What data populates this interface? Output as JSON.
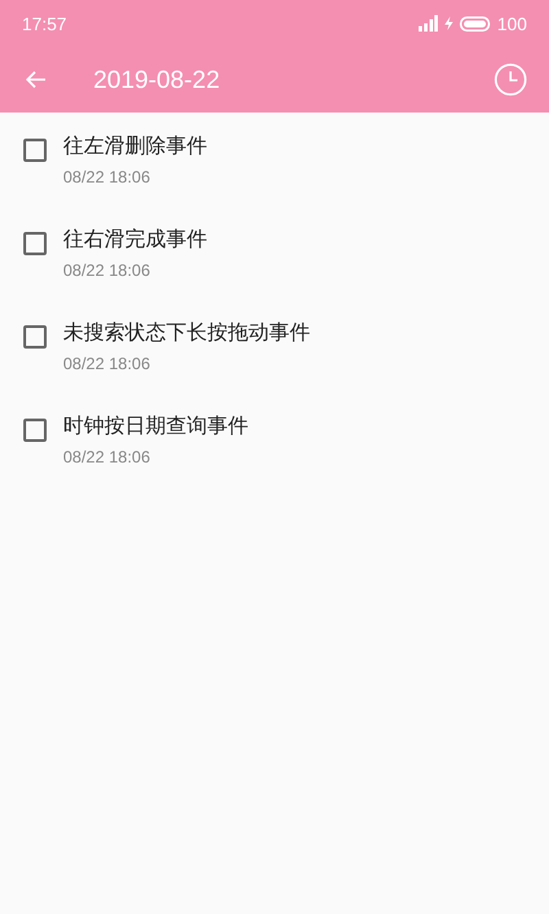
{
  "status_bar": {
    "time": "17:57",
    "battery": "100"
  },
  "toolbar": {
    "title": "2019-08-22"
  },
  "events": [
    {
      "title": "往左滑删除事件",
      "time": "08/22 18:06",
      "checked": false
    },
    {
      "title": "往右滑完成事件",
      "time": "08/22 18:06",
      "checked": false
    },
    {
      "title": "未搜索状态下长按拖动事件",
      "time": "08/22 18:06",
      "checked": false
    },
    {
      "title": "时钟按日期查询事件",
      "time": "08/22 18:06",
      "checked": false
    }
  ]
}
